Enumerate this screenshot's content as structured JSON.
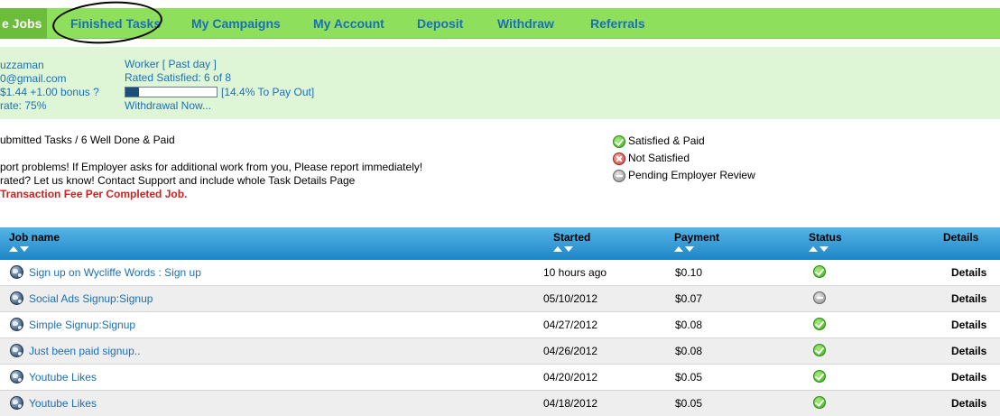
{
  "nav": {
    "active_label": "e Jobs",
    "items": [
      "Finished Tasks",
      "My Campaigns",
      "My Account",
      "Deposit",
      "Withdraw",
      "Referrals"
    ]
  },
  "info": {
    "left_lines": [
      "uzzaman",
      "0@gmail.com",
      "$1.44 +1.00 bonus ?",
      "rate: 75%"
    ],
    "worker_label": "Worker [ Past day ]",
    "rated_satisfied": "Rated Satisfied: 6 of 8",
    "progress_fraction": 0.144,
    "payout_text": "[14.4% To Pay Out]",
    "withdrawal_link": "Withdrawal Now..."
  },
  "messages": {
    "summary": "ubmitted Tasks / 6 Well Done & Paid",
    "report_line": "port problems! If Employer asks for additional work from you, Please report immediately!",
    "rated_line": "rated? Let us know! Contact Support and include whole Task Details Page",
    "fee_line": "Transaction Fee Per Completed Job."
  },
  "legend": {
    "satisfied": "Satisfied & Paid",
    "not_satisfied": "Not Satisfied",
    "pending": "Pending Employer Review"
  },
  "table": {
    "headers": {
      "job_name": "Job name",
      "started": "Started",
      "payment": "Payment",
      "status": "Status",
      "details": "Details"
    },
    "rows": [
      {
        "job": "Sign up on Wycliffe Words : Sign up",
        "started": "10 hours ago",
        "payment": "$0.10",
        "status": "satisfied",
        "details": "Details"
      },
      {
        "job": "Social Ads Signup:Signup",
        "started": "05/10/2012",
        "payment": "$0.07",
        "status": "pending",
        "details": "Details"
      },
      {
        "job": "Simple Signup:Signup",
        "started": "04/27/2012",
        "payment": "$0.08",
        "status": "satisfied",
        "details": "Details"
      },
      {
        "job": "Just been paid signup..",
        "started": "04/26/2012",
        "payment": "$0.08",
        "status": "satisfied",
        "details": "Details"
      },
      {
        "job": "Youtube Likes",
        "started": "04/20/2012",
        "payment": "$0.05",
        "status": "satisfied",
        "details": "Details"
      },
      {
        "job": "Youtube Likes",
        "started": "04/18/2012",
        "payment": "$0.05",
        "status": "satisfied",
        "details": "Details"
      }
    ]
  },
  "colors": {
    "nav_green": "#8ee05c",
    "panel_green": "#dff6d6",
    "link_blue": "#1a6fb8",
    "header_blue": "#1e86c6",
    "fee_red": "#d02020"
  }
}
